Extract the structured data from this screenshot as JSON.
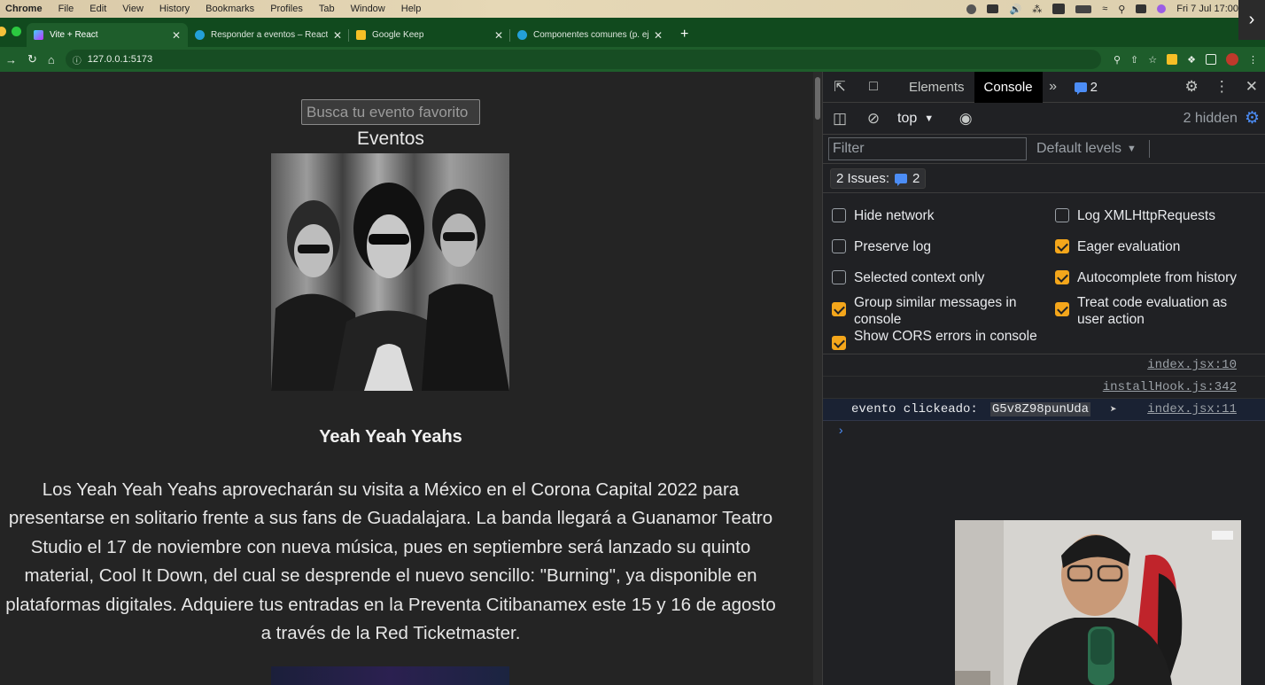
{
  "menubar": {
    "app": "Chrome",
    "items": [
      "File",
      "Edit",
      "View",
      "History",
      "Bookmarks",
      "Profiles",
      "Tab",
      "Window",
      "Help"
    ],
    "clock": "Fri 7 Jul  17:00"
  },
  "browser": {
    "tabs": [
      {
        "title": "Vite + React",
        "favicon_color": "#a46bff",
        "active": true
      },
      {
        "title": "Responder a eventos – React",
        "favicon_color": "#23a0d8",
        "active": false
      },
      {
        "title": "Google Keep",
        "favicon_color": "#f6bf26",
        "active": false
      },
      {
        "title": "Componentes comunes (p. ej.",
        "favicon_color": "#23a0d8",
        "active": false
      }
    ],
    "url": "127.0.0.1:5173"
  },
  "page": {
    "search_placeholder": "Busca tu evento favorito",
    "list_title": "Eventos",
    "event": {
      "name": "Yeah Yeah Yeahs",
      "info": "Los Yeah Yeah Yeahs aprovecharán su visita a México en el Corona Capital 2022 para presentarse en solitario frente a sus fans de Guadalajara. La banda llegará a Guanamor Teatro Studio el 17 de noviembre con nueva música, pues en septiembre será lanzado su quinto material, Cool It Down, del cual se desprende el nuevo sencillo: \"Burning\", ya disponible en plataformas digitales. Adquiere tus entradas en la Preventa Citibanamex este 15 y 16 de agosto a través de la Red Ticketmaster."
    }
  },
  "devtools": {
    "tabs": [
      "Elements",
      "Console"
    ],
    "active_tab": "Console",
    "issues_count": "2",
    "context": "top",
    "hidden": "2 hidden",
    "filter_placeholder": "Filter",
    "levels": "Default levels",
    "issues_label": "2 Issues:",
    "issues_badge": "2",
    "settings_left": [
      {
        "label": "Hide network",
        "checked": false
      },
      {
        "label": "Preserve log",
        "checked": false
      },
      {
        "label": "Selected context only",
        "checked": false
      },
      {
        "label": "Group similar messages in console",
        "checked": true
      },
      {
        "label": "Show CORS errors in console",
        "checked": true
      }
    ],
    "settings_right": [
      {
        "label": "Log XMLHttpRequests",
        "checked": false
      },
      {
        "label": "Eager evaluation",
        "checked": true
      },
      {
        "label": "Autocomplete from history",
        "checked": true
      },
      {
        "label": "Treat code evaluation as user action",
        "checked": true
      }
    ],
    "messages": [
      {
        "text": "",
        "value": "",
        "source": "index.jsx:10"
      },
      {
        "text": "",
        "value": "",
        "source": "installHook.js:342"
      },
      {
        "text": "evento clickeado:",
        "value": "G5v8Z98punUda",
        "source": "index.jsx:11"
      }
    ]
  },
  "colors": {
    "tab_strip": "#114a1e",
    "toolbar": "#1e5d2b",
    "page_bg": "#242424",
    "checkbox_on": "#f4a61b",
    "accent_blue": "#4c8df6"
  }
}
